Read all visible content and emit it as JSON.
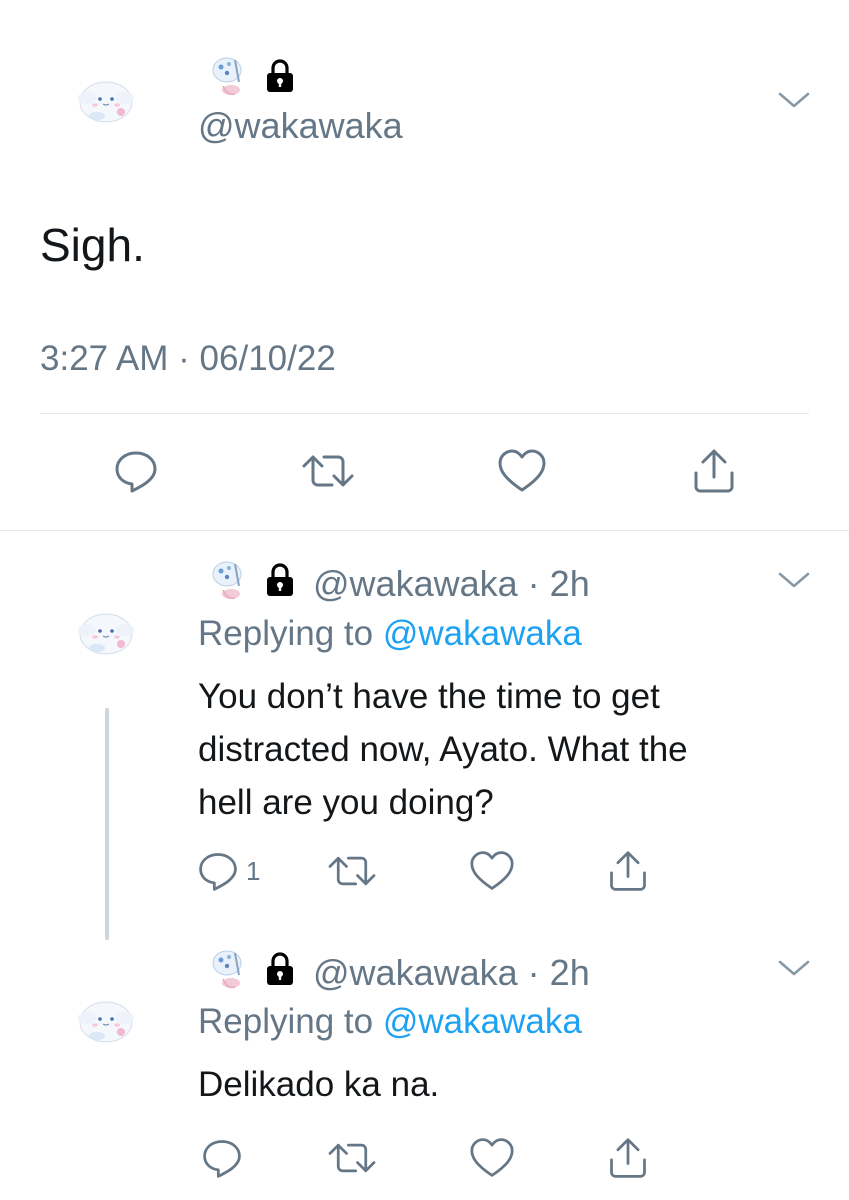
{
  "main_tweet": {
    "handle": "@wakawaka",
    "text": "Sigh.",
    "time": "3:27 AM",
    "separator": "·",
    "date": "06/10/22",
    "actions": [
      "reply-icon",
      "retweet-icon",
      "like-icon",
      "share-icon"
    ]
  },
  "replies": [
    {
      "handle": "@wakawaka",
      "separator": "·",
      "age": "2h",
      "replying_prefix": "Replying to",
      "replying_handle": "@wakawaka",
      "text_lines": [
        "You don’t have the time to get",
        "distracted now, Ayato. What the",
        "hell are you doing?"
      ],
      "reply_count": "1"
    },
    {
      "handle": "@wakawaka",
      "separator": "·",
      "age": "2h",
      "replying_prefix": "Replying to",
      "replying_handle": "@wakawaka",
      "text_lines": [
        "Delikado ka na."
      ],
      "reply_count": ""
    }
  ],
  "colors": {
    "text": "#14171a",
    "secondary": "#657786",
    "link": "#1da1f2",
    "divider": "#e1e8ed",
    "thread_line": "#ccd6dd"
  }
}
